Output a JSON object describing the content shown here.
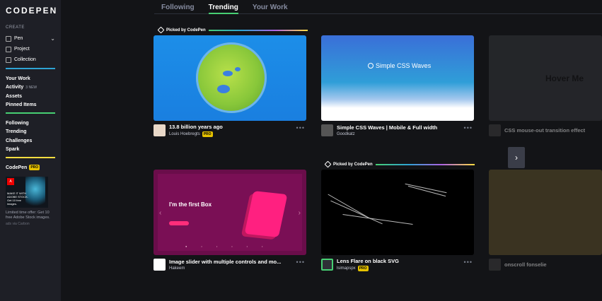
{
  "app": {
    "logo": "CODEPEN"
  },
  "sidebar": {
    "create_label": "CREATE",
    "create_items": [
      {
        "label": "Pen",
        "icon": "pen-icon",
        "has_chevron": true
      },
      {
        "label": "Project",
        "icon": "project-icon"
      },
      {
        "label": "Collection",
        "icon": "collection-icon"
      }
    ],
    "nav_group1": [
      {
        "label": "Your Work"
      },
      {
        "label": "Activity",
        "badge": "3 NEW"
      },
      {
        "label": "Assets"
      },
      {
        "label": "Pinned Items"
      }
    ],
    "nav_group2": [
      {
        "label": "Following"
      },
      {
        "label": "Trending"
      },
      {
        "label": "Challenges"
      },
      {
        "label": "Spark"
      }
    ],
    "codepen_pro": {
      "label": "CodePen",
      "badge": "PRO"
    },
    "ad": {
      "logo_text": "A",
      "image_text": "MAKE IT WITH ADOBE STOCK. Get 10 free images.",
      "caption": "Limited time offer: Get 10 free Adobe Stock images.",
      "via": "ads via Carbon"
    },
    "accent_colors": [
      "#47cf73",
      "#2ea3d4",
      "#ae63e4",
      "#ffdd40"
    ]
  },
  "tabs": [
    {
      "label": "Following",
      "active": false
    },
    {
      "label": "Trending",
      "active": true
    },
    {
      "label": "Your Work",
      "active": false
    }
  ],
  "picked_label": "Picked by CodePen",
  "cards": [
    {
      "title": "13.8 billion years ago",
      "author": "Louis Hoebregts",
      "pro": "PRO",
      "thumb": "earth"
    },
    {
      "title": "Simple CSS Waves | Mobile & Full width",
      "author": "Goodkatz",
      "thumb": "waves",
      "thumb_text": "Simple CSS Waves"
    },
    {
      "title": "CSS mouse-out transition effect",
      "author": "",
      "thumb": "hover",
      "thumb_text": "Hover Me"
    },
    {
      "title": "Image slider with multiple controls and mo...",
      "author": "Hakeem",
      "thumb": "slider",
      "thumb_text": "I'm the first Box"
    },
    {
      "title": "Lens Flare on black SVG",
      "author": "lsimapspx",
      "pro": "PRO",
      "thumb": "lens"
    },
    {
      "title": "onscroll fonselie",
      "author": "",
      "thumb": "grid"
    }
  ],
  "more_icon": "•••",
  "next_icon": "›"
}
